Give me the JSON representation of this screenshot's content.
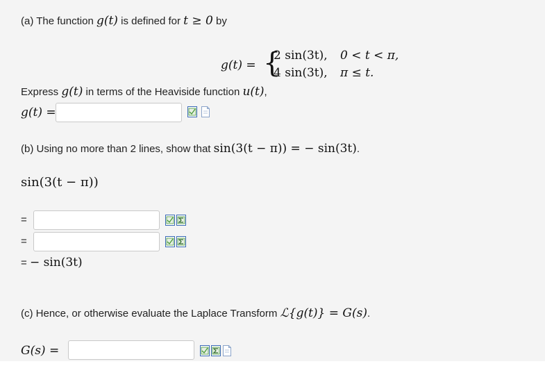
{
  "part_a": {
    "intro_prefix": "(a) The function ",
    "intro_suffix": " is defined for ",
    "intro_end": " by",
    "fn": "g(t)",
    "cond": "t ≥ 0",
    "def_lhs": "g(t) =",
    "case1_expr": "2 sin(3t),",
    "case1_cond": "0 < t < π,",
    "case2_expr": "4 sin(3t),",
    "case2_cond": "π ≤ t.",
    "express_prefix": "Express ",
    "express_mid": " in terms of the Heaviside function ",
    "express_u": "u(t)",
    "express_end": ",",
    "answer_label": "g(t) =",
    "answer_value": ""
  },
  "part_b": {
    "prompt_prefix": "(b) Using no more than 2 lines, show that ",
    "prompt_math": "sin(3(t − π)) = − sin(3t)",
    "prompt_end": ".",
    "start_expr": "sin(3(t − π))",
    "line1_label": "=",
    "line1_value": "",
    "line2_label": "=",
    "line2_value": "",
    "final_label": "=",
    "final_expr": "− sin(3t)"
  },
  "part_c": {
    "prompt_prefix": "(c) Hence, or otherwise evaluate the Laplace Transform ",
    "prompt_math": "ℒ{g(t)} = G(s)",
    "prompt_end": ".",
    "answer_label": "G(s) =",
    "answer_value": ""
  },
  "colors": {
    "panel_bg": "#f4f4f4",
    "icon_green": "#4a9a3a",
    "icon_blue": "#3b6bb5"
  }
}
